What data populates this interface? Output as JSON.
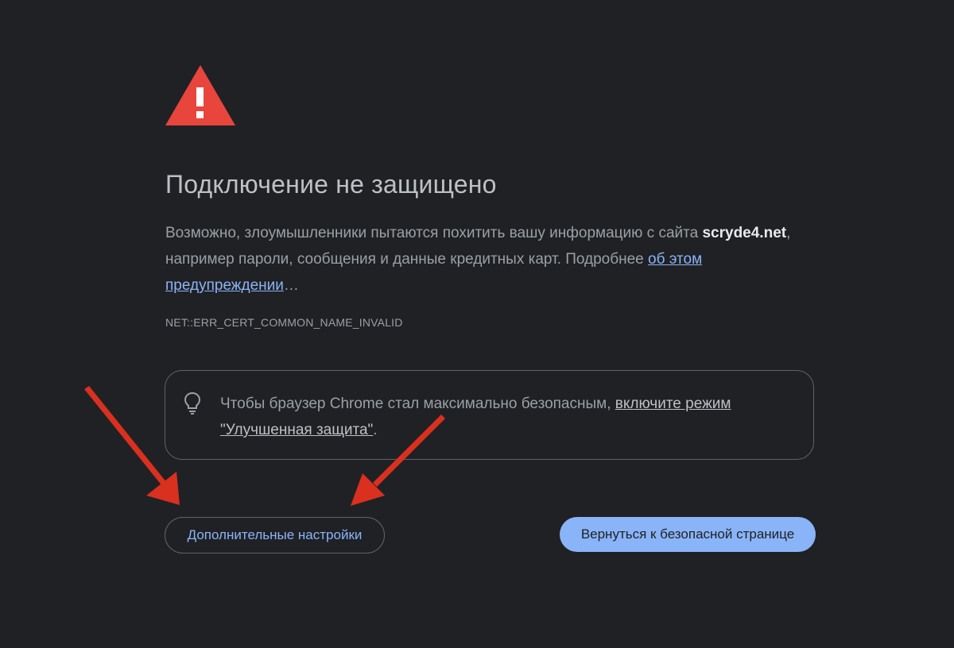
{
  "heading": {
    "title": "Подключение не защищено"
  },
  "message": {
    "part1": "Возможно, злоумышленники пытаются похитить вашу информацию с сайта ",
    "domain": "scryde4.net",
    "part2": ", например пароли, сообщения и данные кредитных карт. Подробнее ",
    "learn_more_link": "об этом предупреждении",
    "ellipsis": "…"
  },
  "error_code": "NET::ERR_CERT_COMMON_NAME_INVALID",
  "tip": {
    "icon": "lightbulb-icon",
    "text_before": "Чтобы браузер Chrome стал максимально безопасным, ",
    "link_text": "включите режим \"Улучшенная защита\"",
    "text_after": "."
  },
  "buttons": {
    "advanced_label": "Дополнительные настройки",
    "back_label": "Вернуться к безопасной странице"
  },
  "colors": {
    "background": "#202124",
    "warning_red": "#d93025",
    "link_blue": "#8ab4f8",
    "annotation_arrow": "#d9301f"
  },
  "icons": {
    "warning": "warning-triangle-icon",
    "arrows": "red-annotation-arrow"
  }
}
